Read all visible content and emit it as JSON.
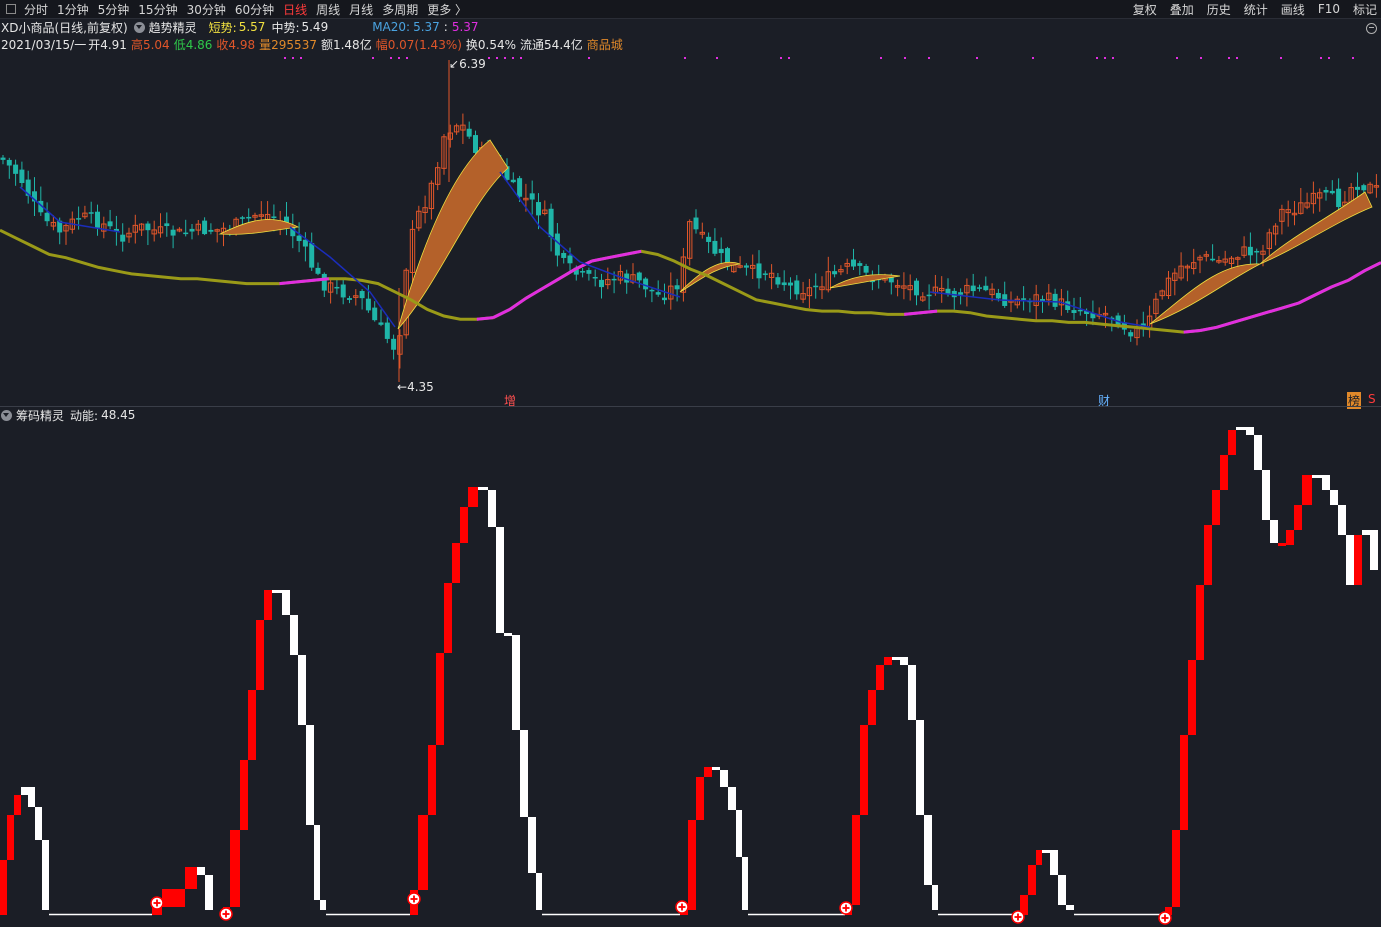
{
  "toolbar": {
    "periods": [
      "分时",
      "1分钟",
      "5分钟",
      "15分钟",
      "30分钟",
      "60分钟",
      "日线",
      "周线",
      "月线",
      "多周期",
      "更多 〉"
    ],
    "active_period": "日线",
    "right_items": [
      "复权",
      "叠加",
      "历史",
      "统计",
      "画线",
      "F10",
      "标记"
    ]
  },
  "legend1": {
    "stock": "XD小商品",
    "mode": "(日线,前复权)",
    "indicator": "趋势精灵",
    "short_label": "短势:",
    "short_value": "5.57",
    "mid_label": "中势:",
    "mid_value": "5.49",
    "ma_label": "MA20:",
    "ma_value1": "5.37",
    "ma_value2": "5.37"
  },
  "legend2": {
    "date": "2021/03/15/一",
    "open": "开4.91",
    "high": "高5.04",
    "low": "低4.86",
    "close": "收4.98",
    "volume": "量295537",
    "amount": "额1.48亿",
    "change": "幅0.07(1.43%)",
    "turnover": "换0.54%",
    "float": "流通54.4亿",
    "sector": "商品城"
  },
  "price_labels": {
    "high": "6.39",
    "low": "4.35"
  },
  "events": [
    {
      "text": "增",
      "color": "#ff5050"
    },
    {
      "text": "财",
      "color": "#66b3ff"
    },
    {
      "text": "榜",
      "color": "#1b1e26",
      "bg": "#e0892a"
    },
    {
      "text": "S",
      "color": "#ff3b3b"
    }
  ],
  "sub_legend": {
    "name": "筹码精灵",
    "label": "动能:",
    "value": "48.45"
  },
  "colors": {
    "up": "#e0562a",
    "down": "#1fb5a8",
    "ma20": "#9a9a18",
    "ma20_up": "#e02ee0",
    "mid_down": "#1b2dbb",
    "band": "#b4612a",
    "energy_up": "#ff0000",
    "energy_down": "#ffffff"
  },
  "chart_data": {
    "type": "candlestick",
    "price_range": [
      4.35,
      6.39
    ],
    "ma20": [
      5.35,
      5.3,
      5.25,
      5.2,
      5.18,
      5.15,
      5.12,
      5.1,
      5.08,
      5.07,
      5.06,
      5.05,
      5.05,
      5.04,
      5.03,
      5.02,
      5.02,
      5.02,
      5.03,
      5.04,
      5.05,
      5.05,
      5.04,
      5.02,
      4.97,
      4.92,
      4.86,
      4.82,
      4.8,
      4.8,
      4.81,
      4.86,
      4.93,
      4.99,
      5.05,
      5.11,
      5.16,
      5.18,
      5.2,
      5.22,
      5.2,
      5.16,
      5.11,
      5.07,
      5.02,
      4.97,
      4.92,
      4.9,
      4.88,
      4.86,
      4.85,
      4.85,
      4.84,
      4.84,
      4.83,
      4.83,
      4.84,
      4.85,
      4.85,
      4.84,
      4.82,
      4.81,
      4.8,
      4.79,
      4.79,
      4.78,
      4.78,
      4.77,
      4.76,
      4.75,
      4.74,
      4.73,
      4.72,
      4.73,
      4.75,
      4.78,
      4.81,
      4.84,
      4.87,
      4.9,
      4.95,
      5.0,
      5.04,
      5.1,
      5.15
    ]
  }
}
